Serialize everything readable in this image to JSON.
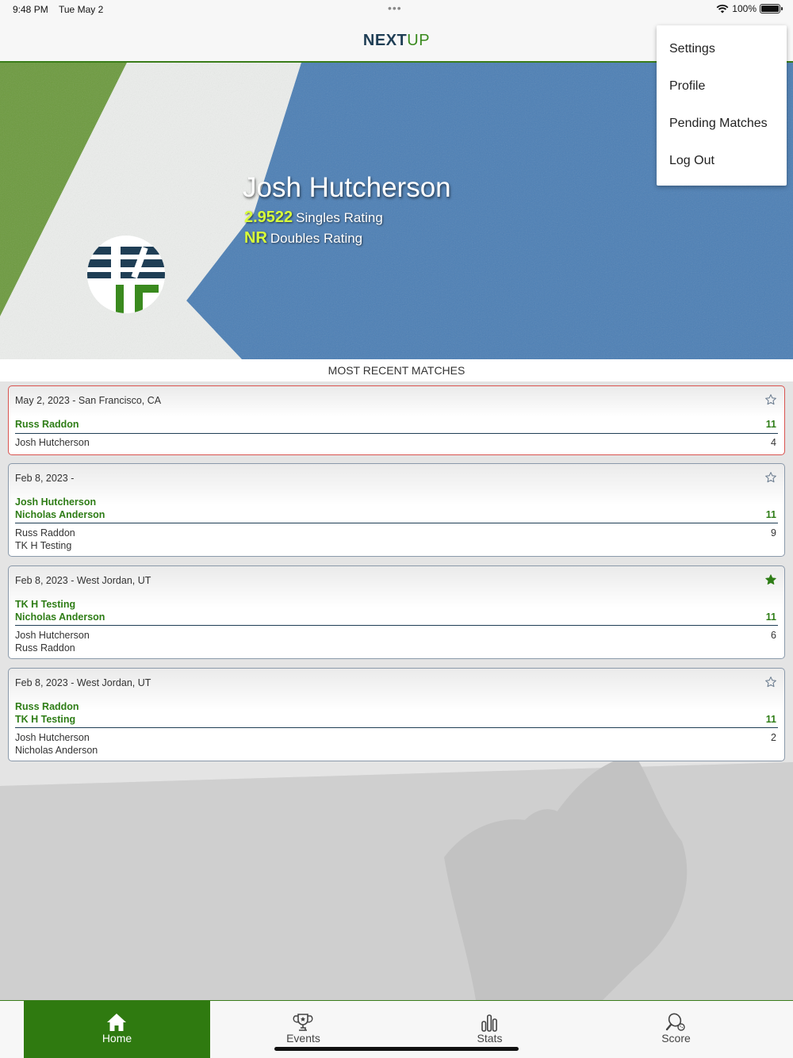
{
  "status_bar": {
    "time": "9:48 PM",
    "date": "Tue May 2",
    "dots": "•••",
    "battery": "100%"
  },
  "app": {
    "logo_next": "NEXT",
    "logo_up": "UP"
  },
  "profile": {
    "name": "Josh Hutcherson",
    "singles_value": "2.9522",
    "singles_label": "Singles Rating",
    "doubles_value": "NR",
    "doubles_label": "Doubles Rating"
  },
  "menu": {
    "items": [
      {
        "label": "Settings"
      },
      {
        "label": "Profile"
      },
      {
        "label": "Pending Matches"
      },
      {
        "label": "Log Out"
      }
    ]
  },
  "section": {
    "title": "MOST RECENT MATCHES"
  },
  "matches": [
    {
      "date": "May 2, 2023 - San Francisco, CA",
      "starred": false,
      "selected": true,
      "winners": [
        "Russ Raddon"
      ],
      "winner_score": "11",
      "losers": [
        "Josh Hutcherson"
      ],
      "loser_score": "4"
    },
    {
      "date": "Feb 8, 2023 -",
      "starred": false,
      "selected": false,
      "winners": [
        "Josh Hutcherson",
        "Nicholas Anderson"
      ],
      "winner_score": "11",
      "losers": [
        "Russ Raddon",
        "TK H Testing"
      ],
      "loser_score": "9"
    },
    {
      "date": "Feb 8, 2023 - West Jordan, UT",
      "starred": true,
      "selected": false,
      "winners": [
        "TK H Testing",
        "Nicholas Anderson"
      ],
      "winner_score": "11",
      "losers": [
        "Josh Hutcherson",
        "Russ Raddon"
      ],
      "loser_score": "6"
    },
    {
      "date": "Feb 8, 2023 - West Jordan, UT",
      "starred": false,
      "selected": false,
      "winners": [
        "Russ Raddon",
        "TK H Testing"
      ],
      "winner_score": "11",
      "losers": [
        "Josh Hutcherson",
        "Nicholas Anderson"
      ],
      "loser_score": "2"
    }
  ],
  "tabs": [
    {
      "label": "Home",
      "icon": "home-icon",
      "active": true
    },
    {
      "label": "Events",
      "icon": "trophy-icon",
      "active": false
    },
    {
      "label": "Stats",
      "icon": "bar-chart-icon",
      "active": false
    },
    {
      "label": "Score",
      "icon": "paddle-ball-icon",
      "active": false
    }
  ],
  "colors": {
    "brand_green": "#2f7a10",
    "brand_navy": "#1f3e55",
    "rating_highlight": "#d8ff3a",
    "court_blue": "#4c7fb5"
  }
}
